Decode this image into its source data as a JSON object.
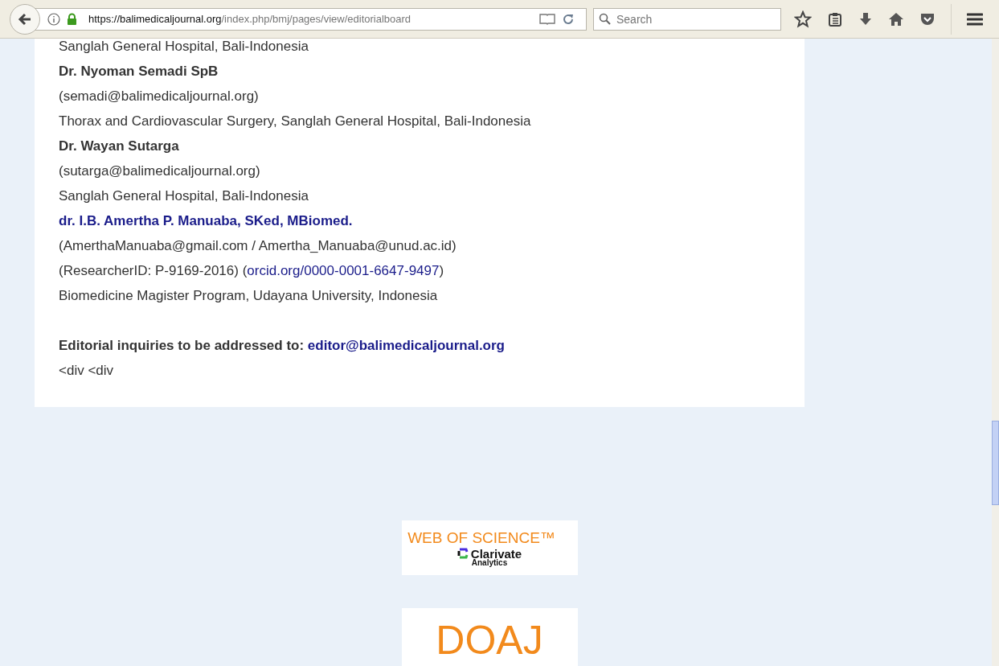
{
  "browser": {
    "url_host": "https://balimedicaljournal.org",
    "url_path": "/index.php/bmj/pages/view/editorialboard",
    "search": {
      "placeholder": "Search"
    }
  },
  "content": {
    "lines": [
      {
        "kind": "text",
        "text": "Sanglah General Hospital, Bali-Indonesia"
      },
      {
        "kind": "name",
        "text": "Dr. Nyoman Semadi SpB"
      },
      {
        "kind": "text",
        "text": "(semadi@balimedicaljournal.org)"
      },
      {
        "kind": "text",
        "text": "Thorax and Cardiovascular Surgery, Sanglah General Hospital, Bali-Indonesia"
      },
      {
        "kind": "name",
        "text": "Dr. Wayan Sutarga"
      },
      {
        "kind": "text",
        "text": "(sutarga@balimedicaljournal.org)"
      },
      {
        "kind": "text",
        "text": "Sanglah General Hospital, Bali-Indonesia"
      },
      {
        "kind": "name-link",
        "text": "dr. I.B. Amertha P. Manuaba, SKed, MBiomed."
      },
      {
        "kind": "text",
        "text": "(AmerthaManuaba@gmail.com / Amertha_Manuaba@unud.ac.id)"
      },
      {
        "kind": "with-link",
        "text": "(ResearcherID: P-9169-2016) (",
        "link": "orcid.org/0000-0001-6647-9497",
        "after": ")"
      },
      {
        "kind": "text",
        "text": "Biomedicine Magister Program, Udayana University, Indonesia"
      },
      {
        "kind": "gap"
      },
      {
        "kind": "bold-with-link",
        "text": "Editorial inquiries to be addressed to: ",
        "link": "editor@balimedicaljournal.org"
      },
      {
        "kind": "text",
        "text": "<div <div"
      }
    ]
  },
  "logos": [
    {
      "kind": "wos",
      "title": "WEB OF SCIENCE™",
      "brand": "Clarivate",
      "sub": "Analytics"
    },
    {
      "kind": "doaj",
      "title": "DOAJ"
    }
  ]
}
